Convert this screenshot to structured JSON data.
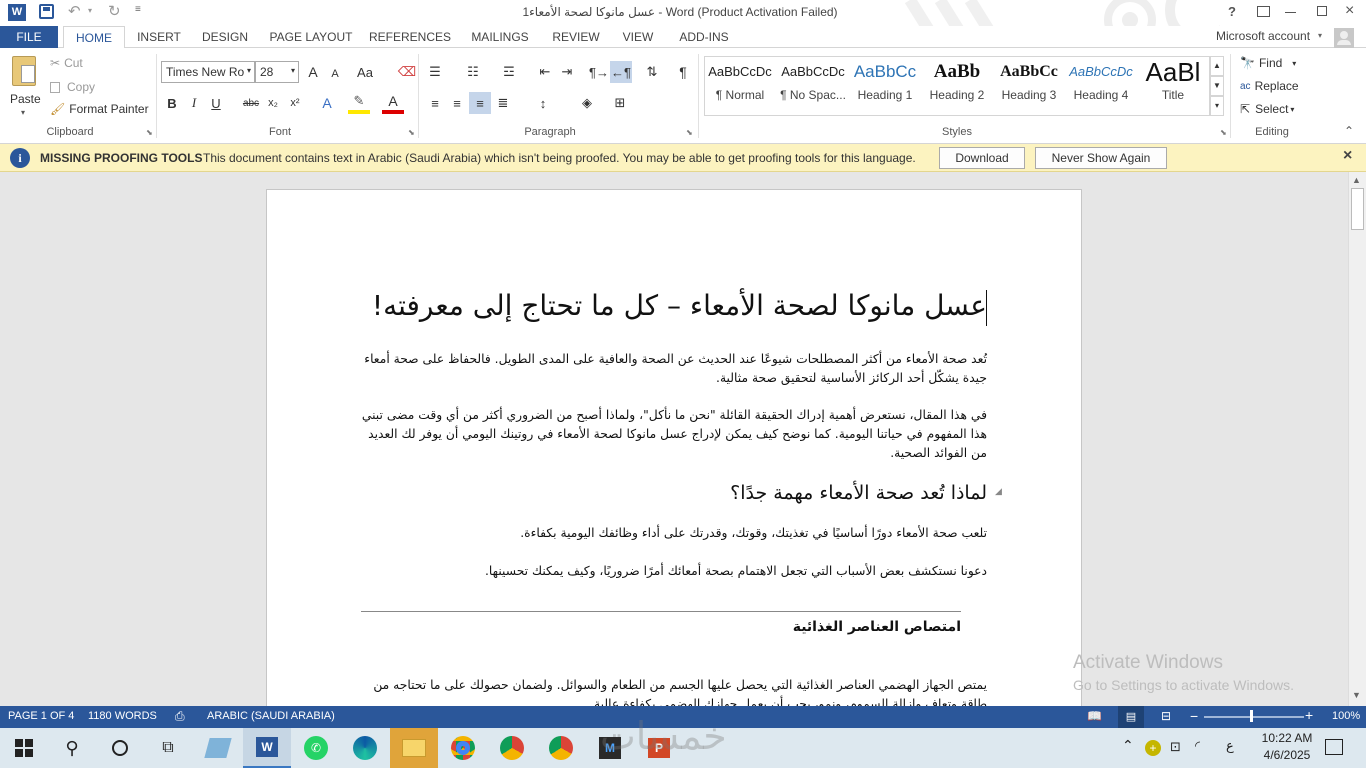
{
  "window": {
    "title": "عسل مانوكا لصحة الأمعاء1 - Word (Product Activation Failed)",
    "help": "?",
    "account": "Microsoft account"
  },
  "tabs": [
    "FILE",
    "HOME",
    "INSERT",
    "DESIGN",
    "PAGE LAYOUT",
    "REFERENCES",
    "MAILINGS",
    "REVIEW",
    "VIEW",
    "ADD-INS"
  ],
  "clipboard": {
    "paste": "Paste",
    "cut": "Cut",
    "copy": "Copy",
    "format_painter": "Format Painter",
    "label": "Clipboard"
  },
  "font": {
    "family": "Times New Ro",
    "size": "28",
    "label": "Font",
    "bold": "B",
    "italic": "I",
    "underline": "U",
    "strike": "abc",
    "sub": "x₂",
    "sup": "x²",
    "grow": "A",
    "shrink": "A",
    "case": "Aa",
    "effects": "A",
    "color": "A"
  },
  "paragraph": {
    "label": "Paragraph",
    "pilcrow": "¶"
  },
  "styles": {
    "label": "Styles",
    "items": [
      {
        "preview": "AaBbCcDc",
        "name": "¶ Normal"
      },
      {
        "preview": "AaBbCcDc",
        "name": "¶ No Spac..."
      },
      {
        "preview": "AaBbCc",
        "name": "Heading 1"
      },
      {
        "preview": "AaBb",
        "name": "Heading 2"
      },
      {
        "preview": "AaBbCc",
        "name": "Heading 3"
      },
      {
        "preview": "AaBbCcDc",
        "name": "Heading 4"
      },
      {
        "preview": "AaBl",
        "name": "Title"
      }
    ]
  },
  "editing": {
    "label": "Editing",
    "find": "Find",
    "replace": "Replace",
    "select": "Select"
  },
  "message_bar": {
    "title": "MISSING PROOFING TOOLS",
    "text": "This document contains text in Arabic (Saudi Arabia) which isn't being proofed. You may be able to get proofing tools for this language.",
    "download": "Download",
    "never": "Never Show Again"
  },
  "document": {
    "title": "عسل مانوكا لصحة الأمعاء – كل ما تحتاج إلى معرفته!",
    "p1": "تُعد صحة الأمعاء من أكثر المصطلحات شيوعًا عند الحديث عن الصحة والعافية على المدى الطويل. فالحفاظ على صحة أمعاء جيدة يشكّل أحد الركائز الأساسية لتحقيق صحة مثالية.",
    "p2": "في هذا المقال، نستعرض أهمية إدراك الحقيقة القائلة \"نحن ما نأكل\"، ولماذا أصبح من الضروري أكثر من أي وقت مضى تبني هذا المفهوم في حياتنا اليومية. كما نوضح كيف يمكن لإدراج عسل مانوكا لصحة الأمعاء في روتينك اليومي أن يوفر لك العديد من الفوائد الصحية.",
    "h2": "لماذا تُعد صحة الأمعاء مهمة جدًا؟",
    "p3": "تلعب صحة الأمعاء دورًا أساسيًا في تغذيتك، وقوتك، وقدرتك على أداء وظائفك اليومية بكفاءة.",
    "p4": "دعونا نستكشف بعض الأسباب التي تجعل الاهتمام بصحة أمعائك أمرًا ضروريًا، وكيف يمكنك تحسينها.",
    "h3": "امتصاص العناصر الغذائية",
    "p5": "يمتص الجهاز الهضمي العناصر الغذائية التي يحصل عليها الجسم من الطعام والسوائل. ولضمان حصولك على ما تحتاجه من طاقة وتعافٍ وإزالة السموم، ونمو، يجب أن يعمل جهازك الهضمي بكفاءة عالية."
  },
  "watermark": {
    "line1": "Activate Windows",
    "line2": "Go to Settings to activate Windows."
  },
  "status": {
    "page": "PAGE 1 OF 4",
    "words": "1180 WORDS",
    "language": "ARABIC (SAUDI ARABIA)",
    "zoom": "100%"
  },
  "taskbar": {
    "time": "10:22 AM",
    "date": "4/6/2025",
    "lang": "ع",
    "watermark": "خمسات"
  },
  "colors": {
    "word_blue": "#2b579a",
    "message_bar": "#fcf3c0",
    "taskbar": "#dde8ef"
  }
}
